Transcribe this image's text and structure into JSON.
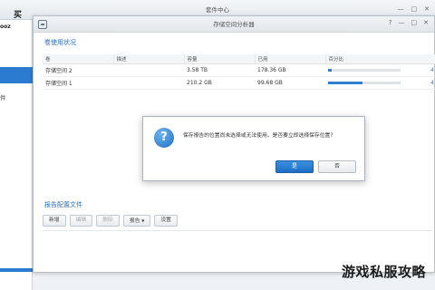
{
  "suite_window": {
    "title": "套件中心",
    "cutoff_text_1": "买",
    "cutoff_text_2": "ooz",
    "left_item": "件"
  },
  "analyzer_window": {
    "title": "存储空间分析器",
    "volume_section_title": "卷使用状况",
    "columns": [
      "卷",
      "描述",
      "容量",
      "已用",
      "百分比"
    ],
    "rows": [
      {
        "volume": "存储空间 2",
        "description": "",
        "capacity": "3.58 TB",
        "used": "178.36 GB",
        "percent": 0.05
      },
      {
        "volume": "存储空间 1",
        "description": "",
        "capacity": "210.2 GB",
        "used": "99.68 GB",
        "percent": 0.47
      }
    ],
    "pct_cutoff": [
      "4",
      "4"
    ],
    "report_section_title": "报告配置文件",
    "toolbar": {
      "new": "新增",
      "edit": "编辑",
      "delete": "删除",
      "report": "报告",
      "settings": "设置"
    }
  },
  "dialog": {
    "message": "保存报告的位置尚未选择或无法使用。是否要立即选择保存位置?",
    "yes_label": "是",
    "no_label": "否",
    "icon_glyph": "?"
  },
  "watermark": "游戏私服攻略",
  "colors": {
    "accent": "#2f80d2",
    "link": "#2a6fb8"
  }
}
